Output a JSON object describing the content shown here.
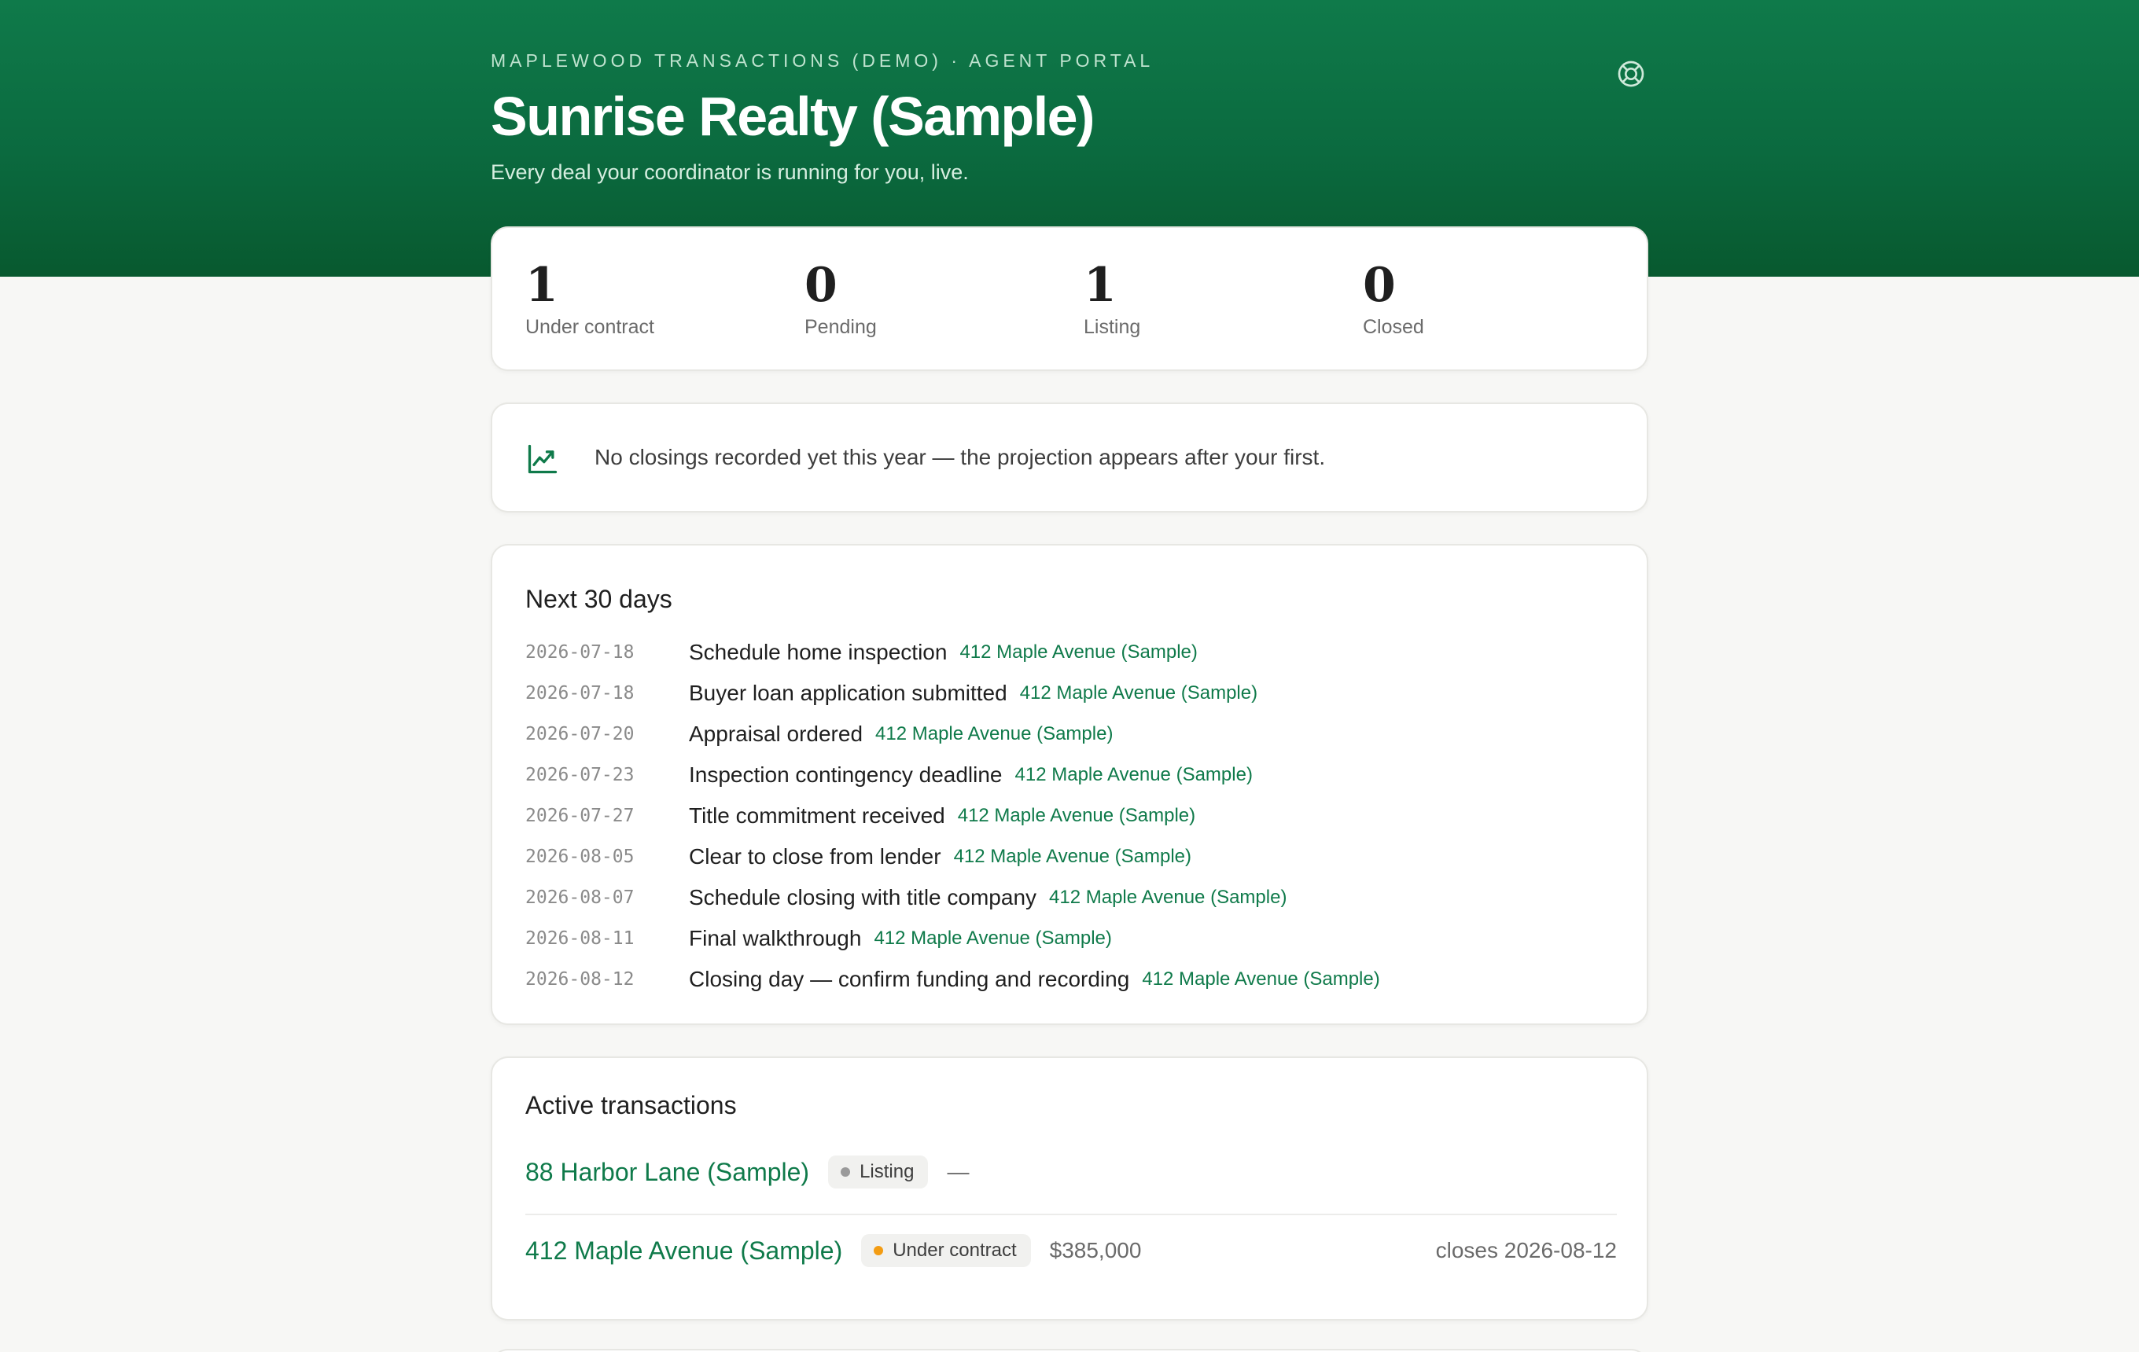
{
  "header": {
    "eyebrow": "MAPLEWOOD TRANSACTIONS (DEMO) · AGENT PORTAL",
    "title": "Sunrise Realty (Sample)",
    "subtitle": "Every deal your coordinator is running for you, live.",
    "help_icon": "lifebuoy-icon"
  },
  "stats": [
    {
      "value": "1",
      "label": "Under contract"
    },
    {
      "value": "0",
      "label": "Pending"
    },
    {
      "value": "1",
      "label": "Listing"
    },
    {
      "value": "0",
      "label": "Closed"
    }
  ],
  "projection": {
    "icon": "trending-up-chart-icon",
    "message": "No closings recorded yet this year — the projection appears after your first."
  },
  "upcoming": {
    "title": "Next 30 days",
    "events": [
      {
        "date": "2026-07-18",
        "title": "Schedule home inspection",
        "property": "412 Maple Avenue (Sample)"
      },
      {
        "date": "2026-07-18",
        "title": "Buyer loan application submitted",
        "property": "412 Maple Avenue (Sample)"
      },
      {
        "date": "2026-07-20",
        "title": "Appraisal ordered",
        "property": "412 Maple Avenue (Sample)"
      },
      {
        "date": "2026-07-23",
        "title": "Inspection contingency deadline",
        "property": "412 Maple Avenue (Sample)"
      },
      {
        "date": "2026-07-27",
        "title": "Title commitment received",
        "property": "412 Maple Avenue (Sample)"
      },
      {
        "date": "2026-08-05",
        "title": "Clear to close from lender",
        "property": "412 Maple Avenue (Sample)"
      },
      {
        "date": "2026-08-07",
        "title": "Schedule closing with title company",
        "property": "412 Maple Avenue (Sample)"
      },
      {
        "date": "2026-08-11",
        "title": "Final walkthrough",
        "property": "412 Maple Avenue (Sample)"
      },
      {
        "date": "2026-08-12",
        "title": "Closing day — confirm funding and recording",
        "property": "412 Maple Avenue (Sample)"
      }
    ]
  },
  "active": {
    "title": "Active transactions",
    "transactions": [
      {
        "name": "88 Harbor Lane (Sample)",
        "status": "Listing",
        "status_color": "#9a9a9a",
        "price": "—",
        "closes": ""
      },
      {
        "name": "412 Maple Avenue (Sample)",
        "status": "Under contract",
        "status_color": "#f39c12",
        "price": "$385,000",
        "closes": "closes 2026-08-12"
      }
    ]
  },
  "colors": {
    "brand_green": "#0f7a4a",
    "hero_dark": "#08592f"
  }
}
